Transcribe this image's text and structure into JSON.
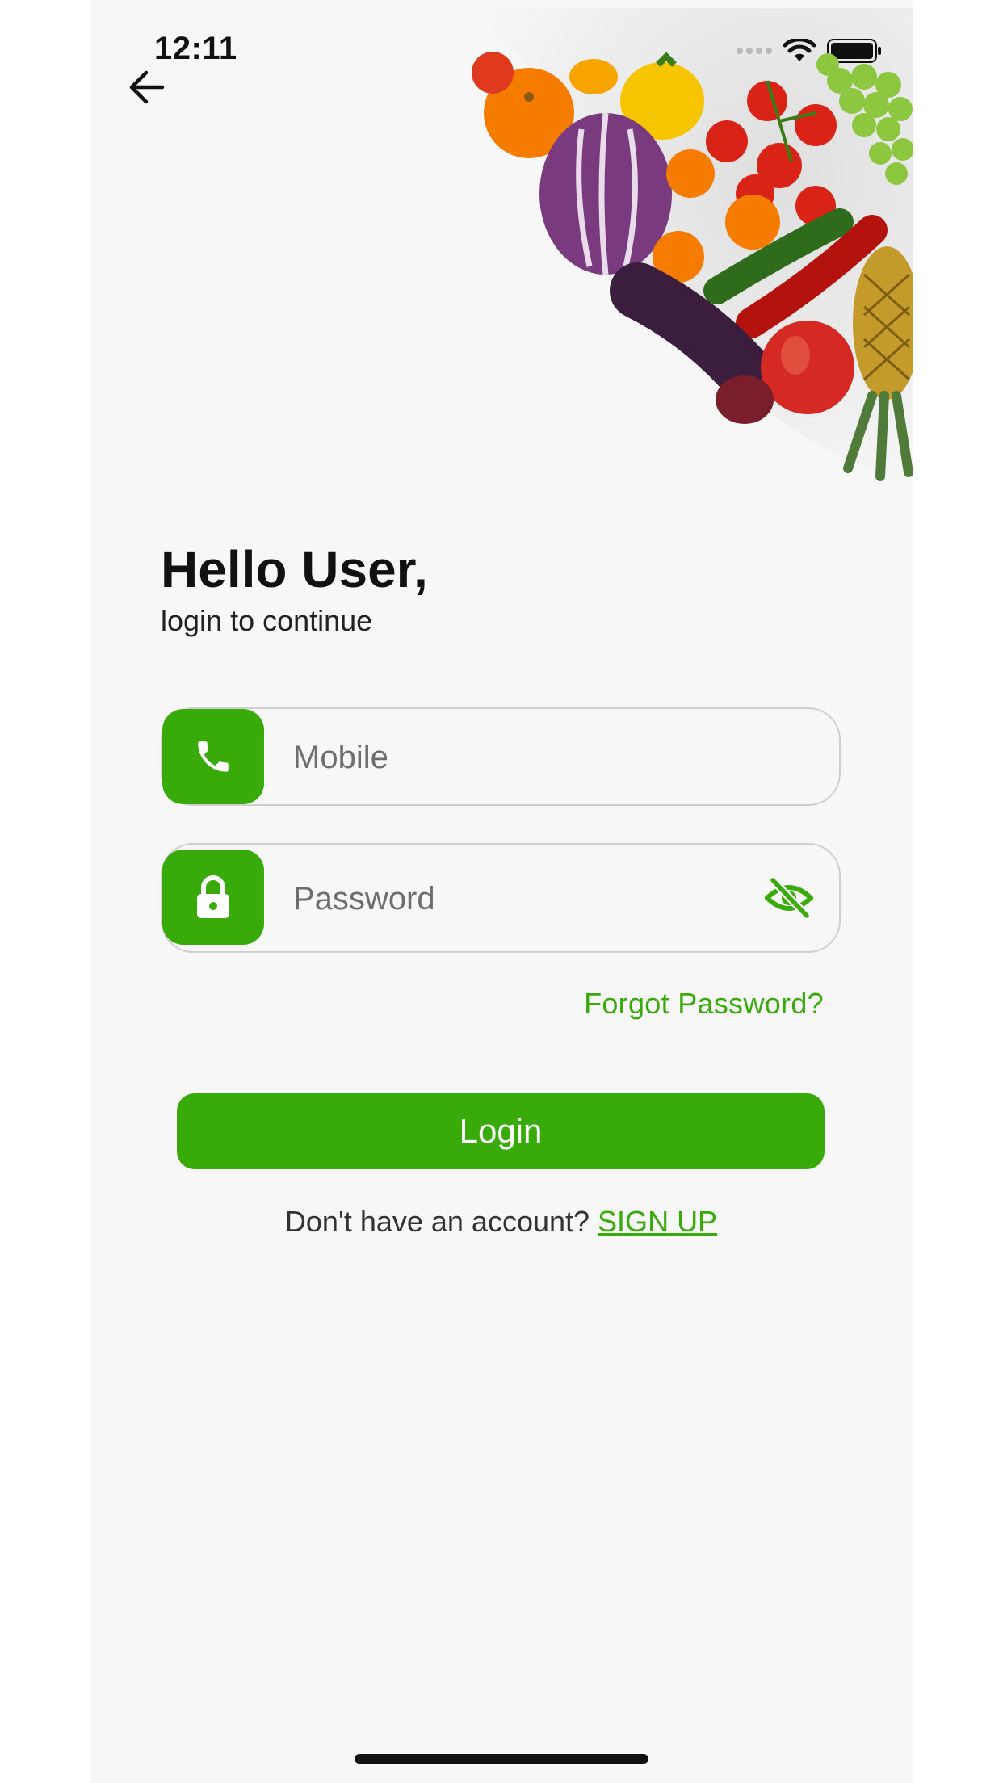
{
  "status_bar": {
    "time": "12:11"
  },
  "icons": {
    "back": "arrow-left-icon",
    "phone": "phone-icon",
    "lock": "lock-icon",
    "eye_off": "eye-off-icon",
    "hero": "vegetables-illustration"
  },
  "header": {
    "greeting": "Hello User,",
    "subtitle": "login to continue"
  },
  "form": {
    "mobile_placeholder": "Mobile",
    "password_placeholder": "Password",
    "forgot_password": "Forgot Password?",
    "login_label": "Login"
  },
  "signup": {
    "prompt": "Don't have an account? ",
    "link_label": "SIGN UP"
  },
  "colors": {
    "accent": "#38ab0b",
    "background": "#f7f7f7"
  }
}
